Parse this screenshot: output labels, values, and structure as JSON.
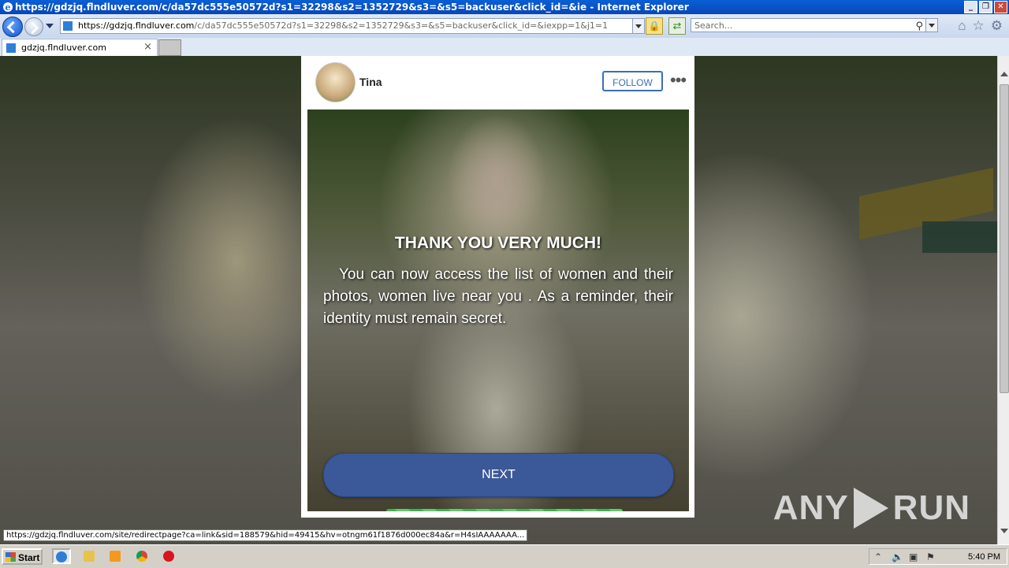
{
  "window": {
    "title": "https://gdzjq.flndluver.com/c/da57dc555e50572d?s1=32298&s2=1352729&s3=&s5=backuser&click_id=&ie - Internet Explorer",
    "controls": [
      "_",
      "❐",
      "✕"
    ]
  },
  "address_bar": {
    "url_host": "https://gdzjq.flndluver.com",
    "url_path": "/c/da57dc555e50572d?s1=32298&s2=1352729&s3=&s5=backuser&click_id=&iexpp=1&j1=1"
  },
  "search": {
    "placeholder": "Search..."
  },
  "tab": {
    "label": "gdzjq.flndluver.com",
    "close": "×"
  },
  "card": {
    "username": "Tina",
    "follow_label": "FOLLOW",
    "more_label": "•••",
    "title": "THANK YOU VERY MUCH!",
    "body": "You can now access the list of women and their photos, women live near you . As a reminder, their identity must remain secret.",
    "next_label": "NEXT",
    "progress": 1.0
  },
  "watermark": {
    "left": "ANY",
    "right": "RUN"
  },
  "status_url": "https://gdzjq.flndluver.com/site/redirectpage?ca=link&sid=188579&hid=49415&hv=otngm61f1876d000ec84a&r=H4sIAAAAAAA...",
  "taskbar": {
    "start_label": "Start",
    "clock": "5:40 PM"
  },
  "colors": {
    "brand_button": "#3b5998",
    "follow_border": "#3b6fb6",
    "progress": "#3fb24f"
  }
}
